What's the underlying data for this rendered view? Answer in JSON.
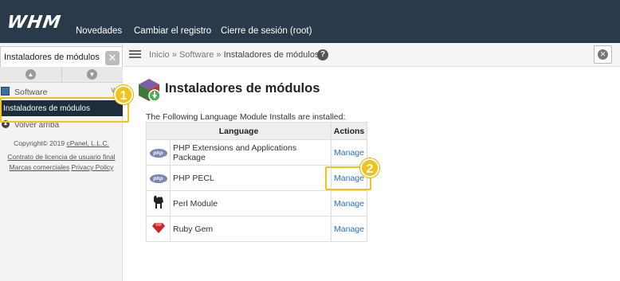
{
  "topbar": {
    "logo": "WHM",
    "nav": [
      "Novedades",
      "Cambiar el registro",
      "Cierre de sesión (root)"
    ]
  },
  "sidebar": {
    "search_value": "Instaladores de módulos",
    "category": "Software",
    "selected_item": "Instaladores de módulos",
    "back_link": "Volver arriba",
    "copyright": "Copyright© 2019 ",
    "copyright_link": "cPanel, L.L.C.",
    "license_link": "Contrato de licencia de usuario final",
    "trademarks_link": "Marcas comerciales",
    "privacy_link": "Privacy Policy"
  },
  "breadcrumb": {
    "home": "Inicio",
    "sep": "»",
    "section": "Software",
    "current": "Instaladores de módulos"
  },
  "main": {
    "title": "Instaladores de módulos",
    "intro": "The Following Language Module Installs are installed:",
    "columns": {
      "language": "Language",
      "actions": "Actions"
    },
    "rows": [
      {
        "icon": "php-icon",
        "language": "PHP Extensions and Applications Package",
        "action": "Manage"
      },
      {
        "icon": "php-icon",
        "language": "PHP PECL",
        "action": "Manage"
      },
      {
        "icon": "perl-camel-icon",
        "language": "Perl Module",
        "action": "Manage"
      },
      {
        "icon": "ruby-gem-icon",
        "language": "Ruby Gem",
        "action": "Manage"
      }
    ]
  },
  "annotations": {
    "badge_1": "1",
    "badge_2": "2",
    "highlight_color": "#f2c318"
  },
  "colors": {
    "topbar": "#293a4a",
    "link": "#2b70b8",
    "selected": "#1d2d3c"
  }
}
